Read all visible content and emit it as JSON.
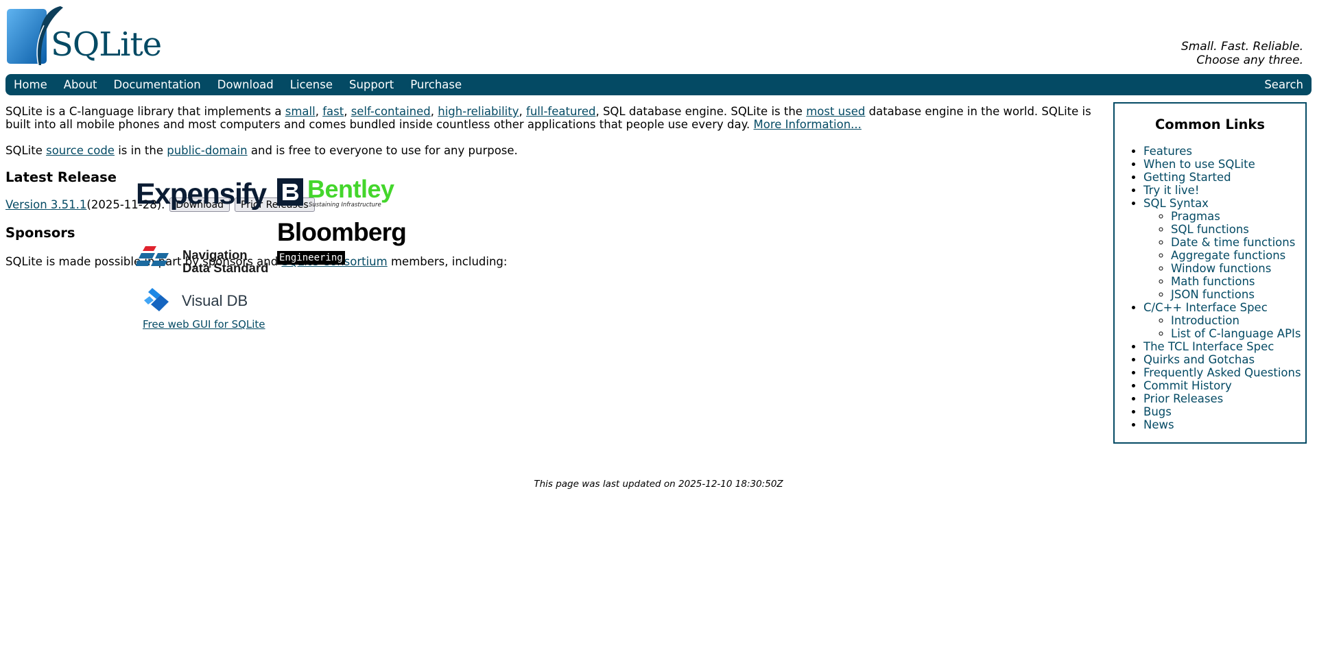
{
  "header": {
    "logo_text": "SQLite",
    "tagline_line1": "Small. Fast. Reliable.",
    "tagline_line2": "Choose any three."
  },
  "menubar": {
    "items": [
      "Home",
      "About",
      "Documentation",
      "Download",
      "License",
      "Support",
      "Purchase"
    ],
    "search_label": "Search"
  },
  "intro": {
    "p1": {
      "t1": "SQLite is a C-language library that implements a ",
      "l_small": "small",
      "t2": ", ",
      "l_fast": "fast",
      "t3": ", ",
      "l_selfcontained": "self-contained",
      "t4": ", ",
      "l_highrel": "high-reliability",
      "t5": ", ",
      "l_fullfeat": "full-featured",
      "t6": ", SQL database engine. SQLite is the ",
      "l_mostused": "most used",
      "t7": " database engine in the world. SQLite is built into all mobile phones and most computers and comes bundled inside countless other applications that people use every day. ",
      "l_more": "More Information..."
    },
    "p2": {
      "t1": "SQLite ",
      "l_source": "source code",
      "t2": " is in the ",
      "l_public": "public-domain",
      "t3": " and is free to everyone to use for any purpose."
    }
  },
  "latest_release": {
    "heading": "Latest Release",
    "version_link": "Version 3.51.1",
    "date": " (2025-11-28).",
    "download_button": "Download",
    "prior_button": "Prior Releases"
  },
  "sponsors": {
    "heading": "Sponsors",
    "t1": "SQLite is made possible in part by sponsors and ",
    "l_consortium": "SQLite Consortium",
    "t2": " members, including:",
    "expensify": "Expensify",
    "bentley": "Bentley",
    "bentley_sub": "Sustaining Infrastructure",
    "bloomberg": "Bloomberg",
    "engineering": "Engineering",
    "nds_line1": "Navigation",
    "nds_line2": "Data Standard",
    "visualdb": "Visual DB",
    "visualdb_link": "Free web GUI for SQLite"
  },
  "sidebar": {
    "title": "Common Links",
    "features": "Features",
    "when": "When to use SQLite",
    "getting_started": "Getting Started",
    "try": "Try it live!",
    "sql_syntax": "SQL Syntax",
    "sql_sub": [
      "Pragmas",
      "SQL functions",
      "Date & time functions",
      "Aggregate functions",
      "Window functions",
      "Math functions",
      "JSON functions"
    ],
    "c_interface": "C/C++ Interface Spec",
    "c_sub": [
      "Introduction",
      "List of C-language APIs"
    ],
    "rest": [
      "The TCL Interface Spec",
      "Quirks and Gotchas",
      "Frequently Asked Questions",
      "Commit History",
      "Prior Releases",
      "Bugs",
      "News"
    ]
  },
  "footer": {
    "text": "This page was last updated on 2025-12-10 18:30:50Z"
  },
  "colors": {
    "accent": "#044a64",
    "bentley_green": "#44d62c"
  }
}
